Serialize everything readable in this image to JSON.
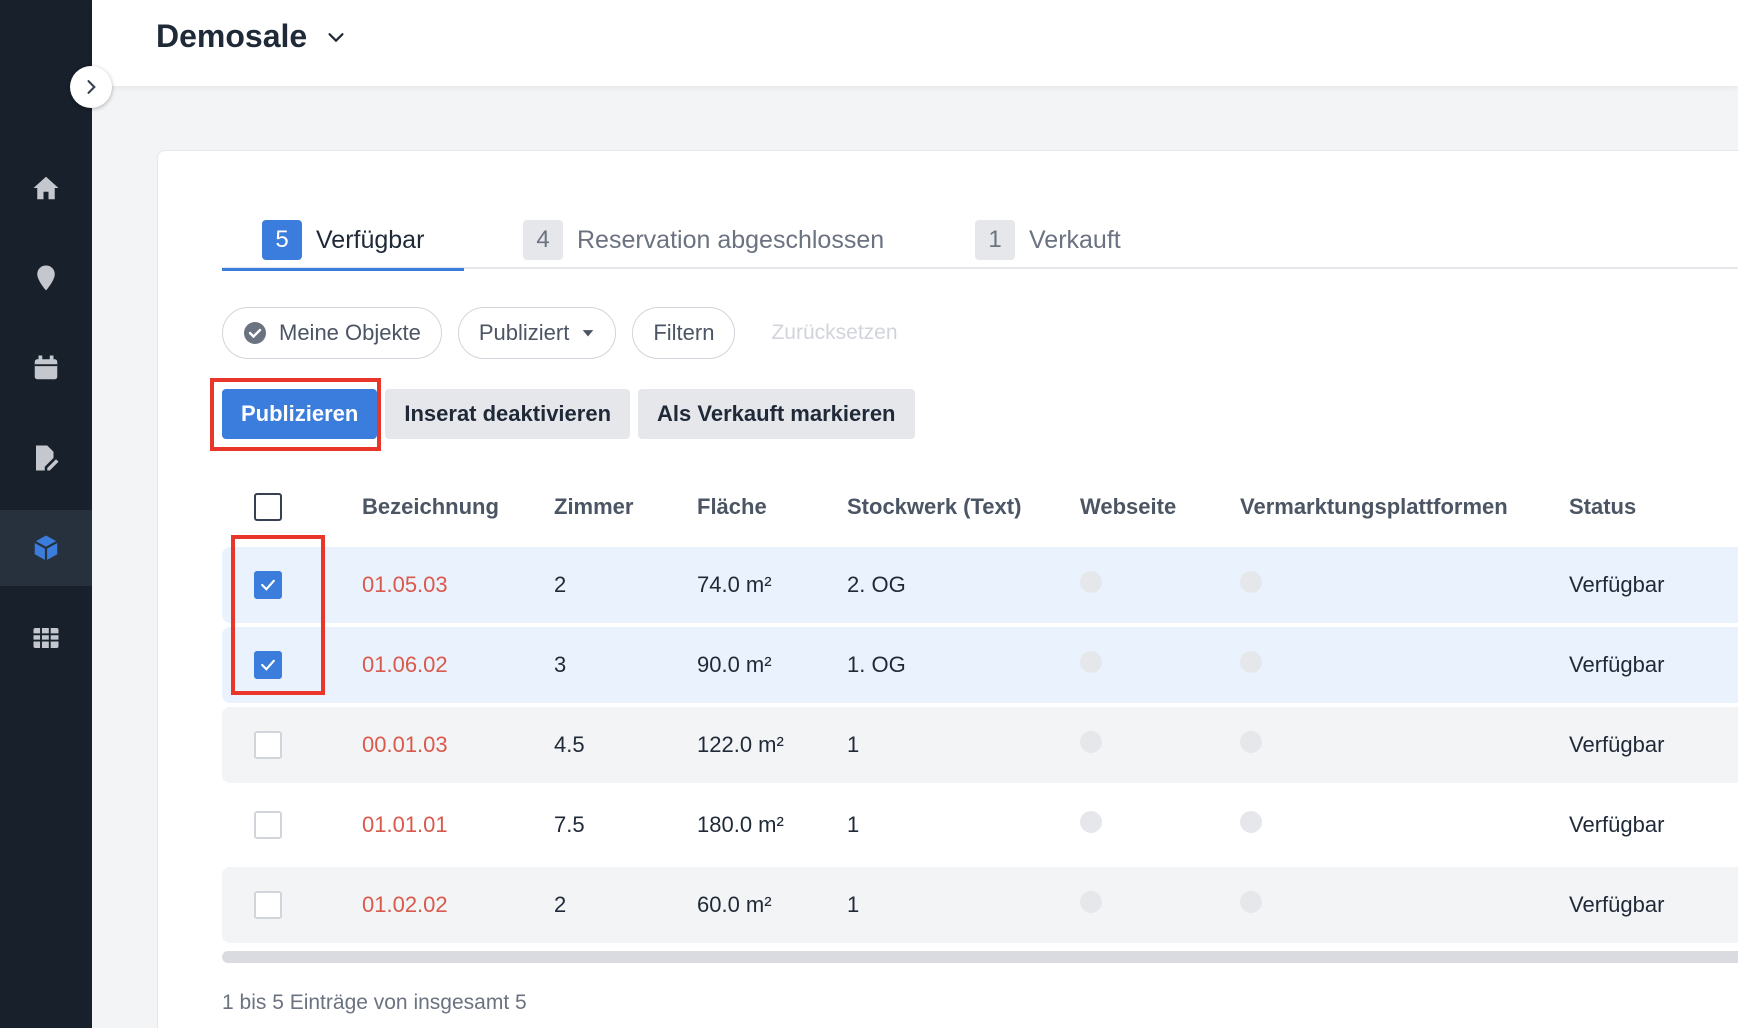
{
  "header": {
    "title": "Demosale"
  },
  "sidebar": {
    "items": [
      {
        "icon": "home-icon",
        "active": false
      },
      {
        "icon": "location-pin-icon",
        "active": false
      },
      {
        "icon": "calendar-icon",
        "active": false
      },
      {
        "icon": "document-edit-icon",
        "active": false
      },
      {
        "icon": "cube-icon",
        "active": true
      },
      {
        "icon": "table-grid-icon",
        "active": false
      }
    ]
  },
  "tabs": [
    {
      "count": "5",
      "label": "Verfügbar",
      "active": true
    },
    {
      "count": "4",
      "label": "Reservation abgeschlossen",
      "active": false
    },
    {
      "count": "1",
      "label": "Verkauft",
      "active": false
    }
  ],
  "filters": {
    "my_objects": "Meine Objekte",
    "published": "Publiziert",
    "filter": "Filtern",
    "reset": "Zurücksetzen"
  },
  "actions": {
    "publish": "Publizieren",
    "deactivate": "Inserat deaktivieren",
    "mark_sold": "Als Verkauft markieren"
  },
  "table": {
    "columns": [
      "Bezeichnung",
      "Zimmer",
      "Fläche",
      "Stockwerk (Text)",
      "Webseite",
      "Vermarktungsplattformen",
      "Status"
    ],
    "rows": [
      {
        "checked": true,
        "bez": "01.05.03",
        "zimmer": "2",
        "flaeche": "74.0 m²",
        "stockwerk": "2. OG",
        "status": "Verfügbar"
      },
      {
        "checked": true,
        "bez": "01.06.02",
        "zimmer": "3",
        "flaeche": "90.0 m²",
        "stockwerk": "1. OG",
        "status": "Verfügbar"
      },
      {
        "checked": false,
        "bez": "00.01.03",
        "zimmer": "4.5",
        "flaeche": "122.0 m²",
        "stockwerk": "1",
        "status": "Verfügbar"
      },
      {
        "checked": false,
        "bez": "01.01.01",
        "zimmer": "7.5",
        "flaeche": "180.0 m²",
        "stockwerk": "1",
        "status": "Verfügbar"
      },
      {
        "checked": false,
        "bez": "01.02.02",
        "zimmer": "2",
        "flaeche": "60.0 m²",
        "stockwerk": "1",
        "status": "Verfügbar"
      }
    ]
  },
  "footer": {
    "entries": "1 bis 5 Einträge von insgesamt 5"
  },
  "colors": {
    "accent": "#3b7ddd",
    "link": "#d9594c",
    "highlight": "#e8362b",
    "sidebar": "#17202b"
  }
}
